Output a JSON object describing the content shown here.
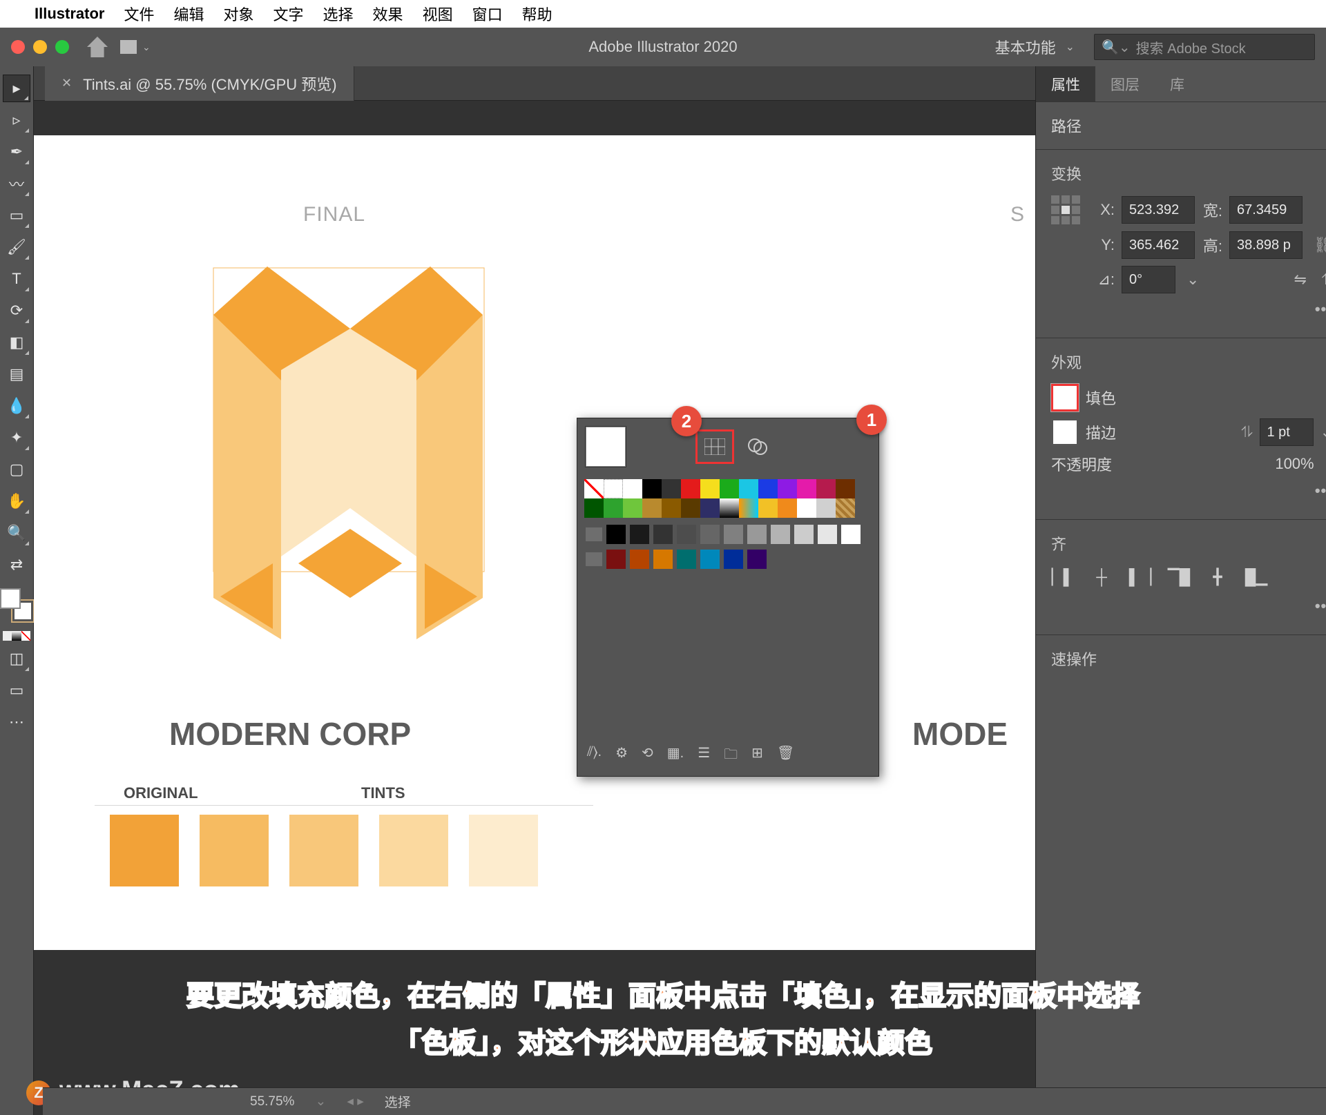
{
  "menubar": {
    "app": "Illustrator",
    "items": [
      "文件",
      "编辑",
      "对象",
      "文字",
      "选择",
      "效果",
      "视图",
      "窗口",
      "帮助"
    ]
  },
  "titlebar": {
    "title": "Adobe Illustrator 2020",
    "preset": "基本功能",
    "search_placeholder": "搜索 Adobe Stock"
  },
  "doctab": {
    "name": "Tints.ai @ 55.75% (CMYK/GPU 预览)"
  },
  "artboard": {
    "final": "FINAL",
    "st": "S",
    "brand": "MODERN CORP",
    "brand2": "MODE",
    "original": "ORIGINAL",
    "tints": "TINTS",
    "tint_colors": [
      "#f2a238",
      "#f6bb61",
      "#f8c77a",
      "#fbd99f",
      "#fdecce"
    ]
  },
  "panels": {
    "tabs": [
      "属性",
      "图层",
      "库"
    ],
    "path_label": "路径",
    "transform": {
      "h": "变换",
      "X": "X:",
      "Xv": "523.392",
      "Y": "Y:",
      "Yv": "365.462",
      "W": "宽:",
      "Wv": "67.3459",
      "H": "高:",
      "Hv": "38.898 p",
      "rot": "⊿:",
      "rotv": "0°"
    },
    "appearance": {
      "h": "外观",
      "fill": "填色",
      "stroke": "描边",
      "strokeV": "1 pt",
      "opacity": "不透明度",
      "opacityV": "100%"
    },
    "align": {
      "h": "齐"
    },
    "quick": "速操作"
  },
  "colorpanel": {
    "row1": [
      "#ffffff",
      "#000000",
      "#7f7f7f",
      "#ff0000",
      "#ff9900",
      "#ffff00",
      "#33cc33",
      "#00ccff",
      "#0066ff",
      "#9933ff",
      "#ff33cc",
      "#cc0066",
      "#996633",
      "#4d0000"
    ],
    "row2": [
      "#006600",
      "#009900",
      "#66cc33",
      "#cc9933",
      "#996600",
      "#663300",
      "#333366",
      "#0099cc",
      "#003399",
      "#ffcc00",
      "#ff6600",
      "#ffffff",
      "#cccccc",
      "#c09850"
    ],
    "row3": [
      "#000000",
      "#1a1a1a",
      "#333333",
      "#4d4d4d",
      "#666666",
      "#808080",
      "#999999",
      "#b3b3b3",
      "#cccccc",
      "#e6e6e6",
      "#ffffff"
    ],
    "row4": [
      "#660000",
      "#993300",
      "#cc6600",
      "#006666",
      "#0099cc",
      "#003399",
      "#330066"
    ]
  },
  "callouts": {
    "c1": "1",
    "c2": "2"
  },
  "caption_l1": "要更改填充颜色，在右侧的「属性」面板中点击「填色」，在显示的面板中选择",
  "caption_l2": "「色板」，对这个形状应用色板下的默认颜色",
  "watermark": "www.MacZ.com",
  "status": {
    "zoom": "55.75%",
    "sel": "选择"
  }
}
